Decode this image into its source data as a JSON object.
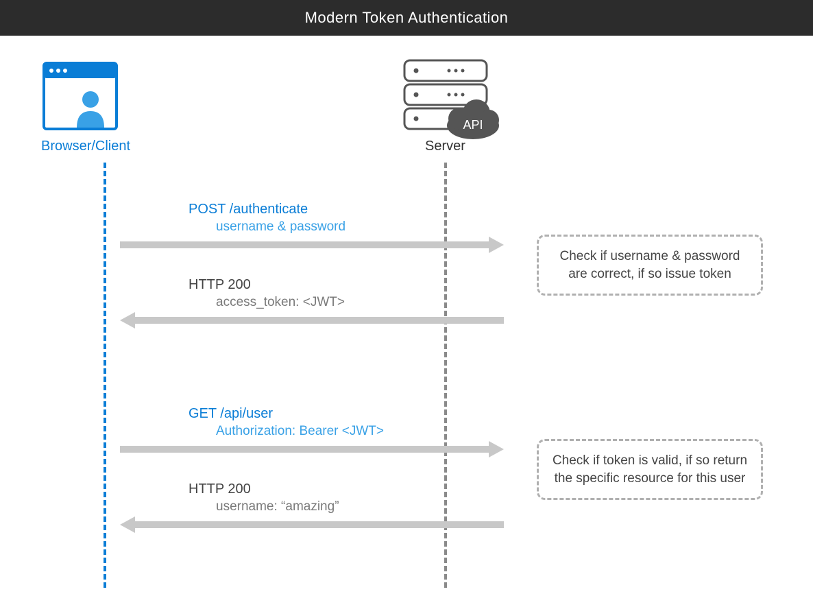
{
  "title": "Modern Token Authentication",
  "client": {
    "label": "Browser/Client"
  },
  "server": {
    "label": "Server",
    "api_badge": "API"
  },
  "flows": {
    "f1": {
      "title": "POST /authenticate",
      "sub": "username & password"
    },
    "f2": {
      "title": "HTTP 200",
      "sub": "access_token: <JWT>"
    },
    "f3": {
      "title": "GET /api/user",
      "sub": "Authorization: Bearer <JWT>"
    },
    "f4": {
      "title": "HTTP 200",
      "sub": "username: “amazing”"
    }
  },
  "notes": {
    "n1": "Check if username & password are correct, if so issue token",
    "n2": "Check if token is valid, if so return the specific resource for this user"
  }
}
